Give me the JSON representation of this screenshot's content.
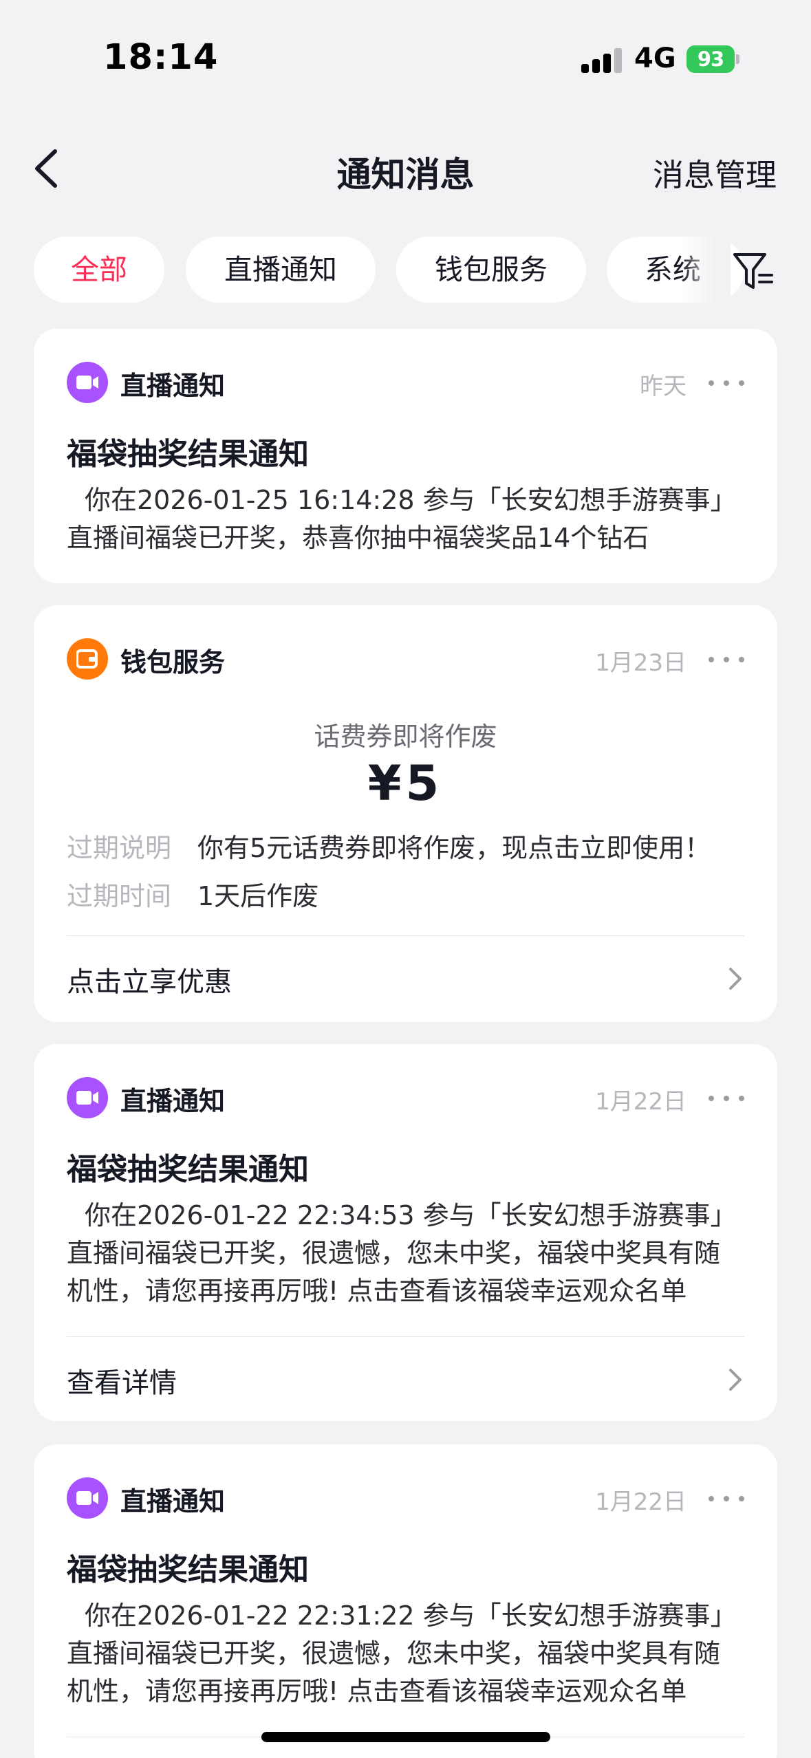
{
  "status_bar": {
    "time": "18:14",
    "network": "4G",
    "battery": "93"
  },
  "nav": {
    "title": "通知消息",
    "action": "消息管理",
    "back_icon": "chevron-left-icon"
  },
  "tabs": [
    {
      "label": "全部",
      "active": true
    },
    {
      "label": "直播通知",
      "active": false
    },
    {
      "label": "钱包服务",
      "active": false
    },
    {
      "label": "系统",
      "active": false
    }
  ],
  "filter_icon": "filter-icon",
  "notifications": [
    {
      "source": "直播通知",
      "source_icon": "video-camera-icon",
      "date": "昨天",
      "title": "福袋抽奖结果通知",
      "body": "你在2026-01-25 16:14:28 参与「长安幻想手游赛事」直播间福袋已开奖，恭喜你抽中福袋奖品14个钻石"
    },
    {
      "source": "钱包服务",
      "source_icon": "wallet-icon",
      "date": "1月23日",
      "coupon_title": "话费券即将作废",
      "amount": "¥5",
      "fields": [
        {
          "key": "过期说明",
          "value": "你有5元话费券即将作废，现点击立即使用！"
        },
        {
          "key": "过期时间",
          "value": "1天后作废"
        }
      ],
      "link": "点击立享优惠"
    },
    {
      "source": "直播通知",
      "source_icon": "video-camera-icon",
      "date": "1月22日",
      "title": "福袋抽奖结果通知",
      "body": "你在2026-01-22 22:34:53 参与「长安幻想手游赛事」直播间福袋已开奖，很遗憾，您未中奖，福袋中奖具有随机性，请您再接再厉哦! 点击查看该福袋幸运观众名单",
      "link": "查看详情"
    },
    {
      "source": "直播通知",
      "source_icon": "video-camera-icon",
      "date": "1月22日",
      "title": "福袋抽奖结果通知",
      "body": "你在2026-01-22 22:31:22 参与「长安幻想手游赛事」直播间福袋已开奖，很遗憾，您未中奖，福袋中奖具有随机性，请您再接再厉哦! 点击查看该福袋幸运观众名单"
    }
  ],
  "colors": {
    "accent": "#fe2c55",
    "live": "#a751ff",
    "wallet": "#ff7a0b",
    "battery": "#34c759"
  }
}
